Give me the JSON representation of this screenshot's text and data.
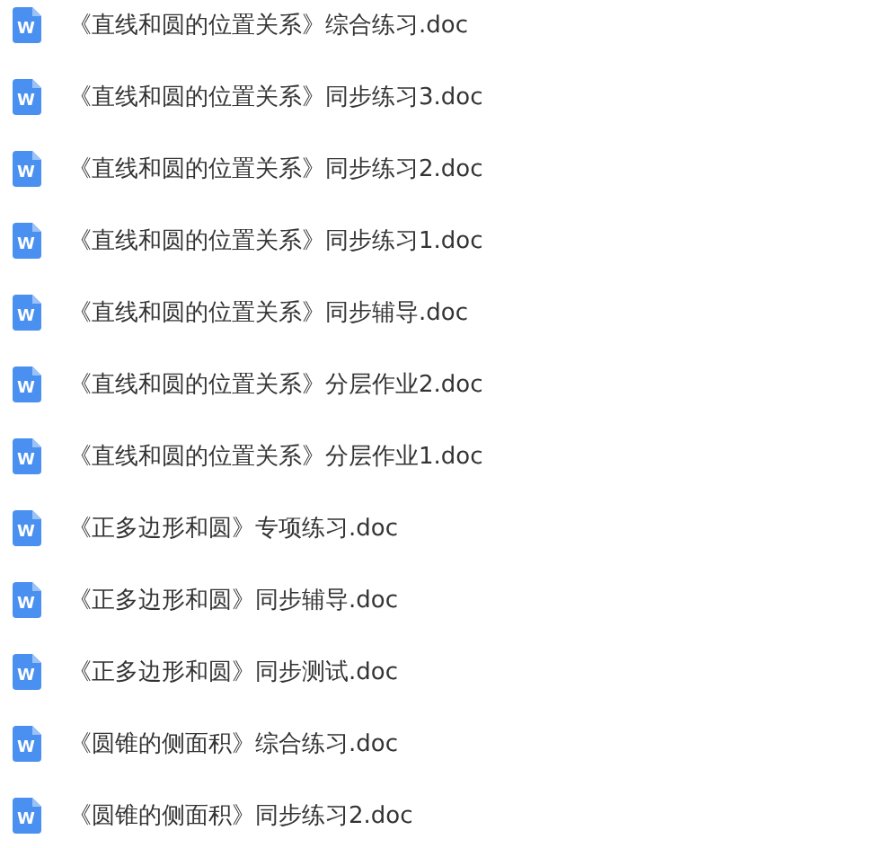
{
  "files": [
    {
      "icon_label": "W",
      "name": "《直线和圆的位置关系》综合练习.doc"
    },
    {
      "icon_label": "W",
      "name": "《直线和圆的位置关系》同步练习3.doc"
    },
    {
      "icon_label": "W",
      "name": "《直线和圆的位置关系》同步练习2.doc"
    },
    {
      "icon_label": "W",
      "name": "《直线和圆的位置关系》同步练习1.doc"
    },
    {
      "icon_label": "W",
      "name": "《直线和圆的位置关系》同步辅导.doc"
    },
    {
      "icon_label": "W",
      "name": "《直线和圆的位置关系》分层作业2.doc"
    },
    {
      "icon_label": "W",
      "name": "《直线和圆的位置关系》分层作业1.doc"
    },
    {
      "icon_label": "W",
      "name": "《正多边形和圆》专项练习.doc"
    },
    {
      "icon_label": "W",
      "name": "《正多边形和圆》同步辅导.doc"
    },
    {
      "icon_label": "W",
      "name": "《正多边形和圆》同步测试.doc"
    },
    {
      "icon_label": "W",
      "name": "《圆锥的侧面积》综合练习.doc"
    },
    {
      "icon_label": "W",
      "name": "《圆锥的侧面积》同步练习2.doc"
    }
  ]
}
